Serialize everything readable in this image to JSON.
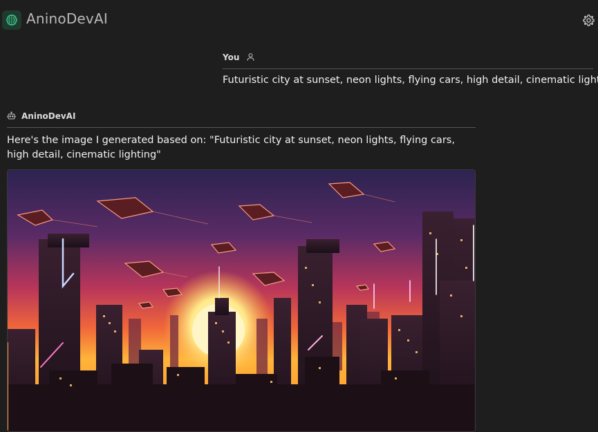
{
  "app": {
    "title": "AninoDevAI",
    "logo_icon": "brain-chip-icon",
    "settings_icon": "gear-icon"
  },
  "user_message": {
    "author": "You",
    "author_icon": "user-icon",
    "text": "Futuristic city at sunset, neon lights, flying cars, high detail, cinematic lighting"
  },
  "assistant_message": {
    "author": "AninoDevAI",
    "author_icon": "robot-icon",
    "text": "Here's the image I generated based on: \"Futuristic city at sunset, neon lights, flying cars, high detail, cinematic lighting\"",
    "image_alt": "Generated image: futuristic city at sunset with neon lights and flying cars"
  },
  "colors": {
    "background": "#1e1e1e",
    "logo_bg": "#1f3a2f",
    "logo_accent": "#3ecf8e"
  }
}
